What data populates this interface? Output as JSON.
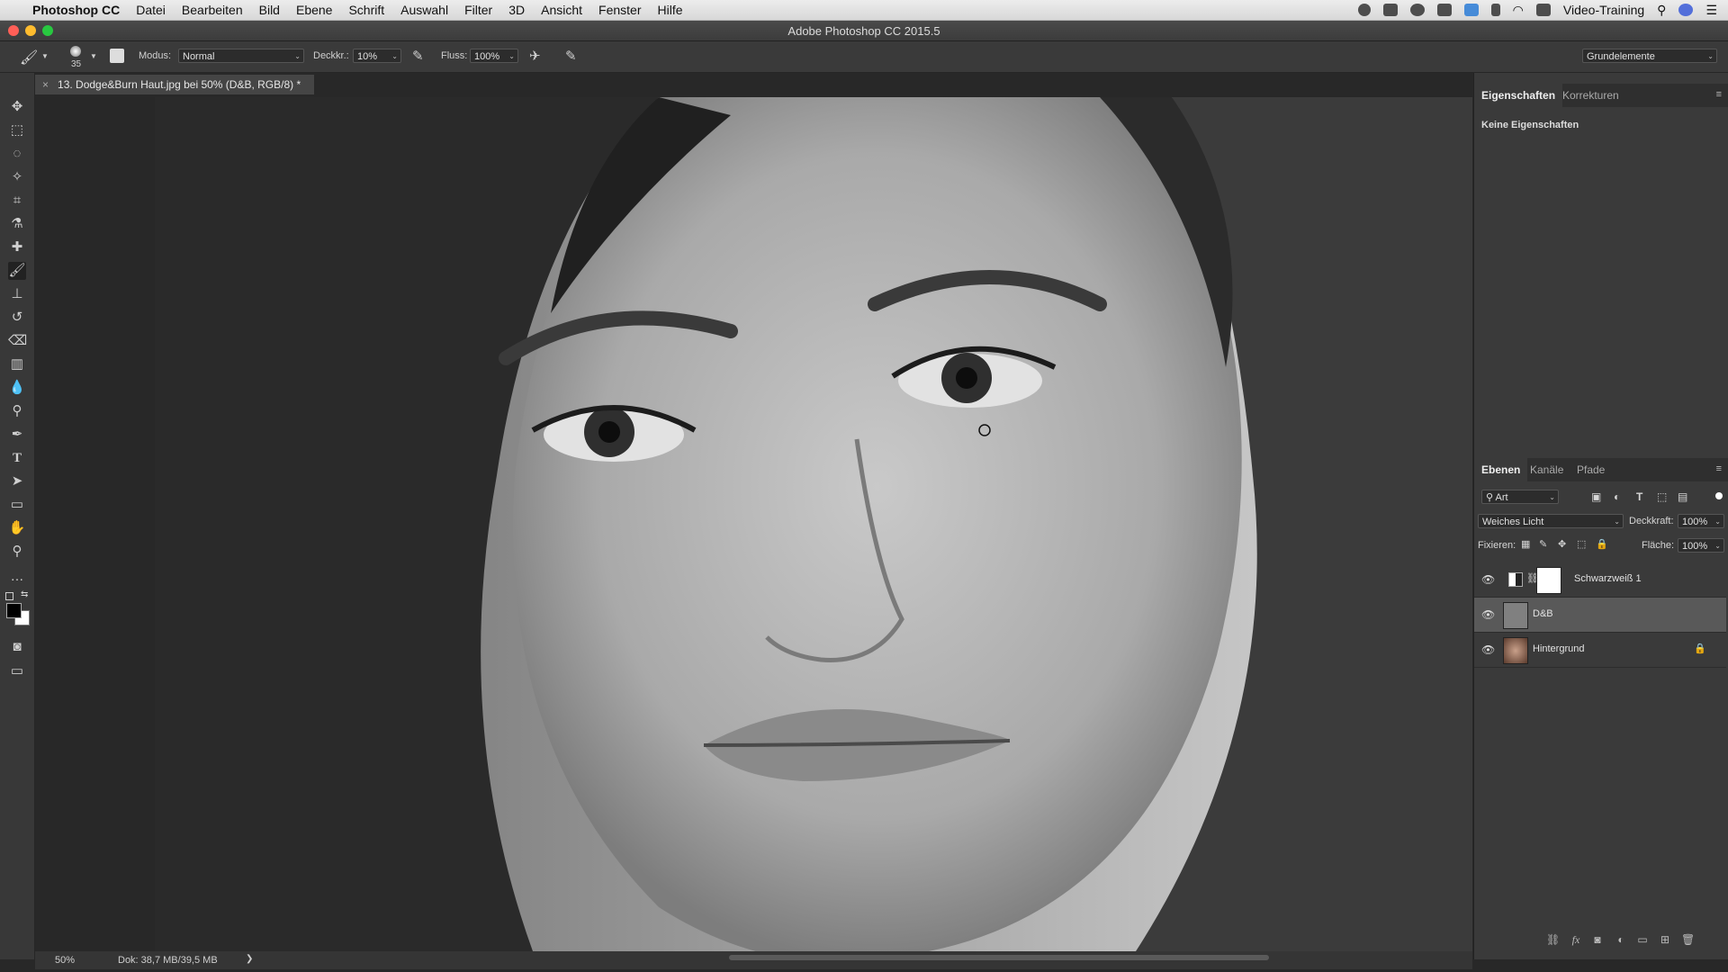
{
  "menubar": {
    "app": "Photoshop CC",
    "items": [
      "Datei",
      "Bearbeiten",
      "Bild",
      "Ebene",
      "Schrift",
      "Auswahl",
      "Filter",
      "3D",
      "Ansicht",
      "Fenster",
      "Hilfe"
    ],
    "user": "Video-Training"
  },
  "window": {
    "title": "Adobe Photoshop CC 2015.5"
  },
  "options": {
    "brush_size": "35",
    "mode_label": "Modus:",
    "mode_value": "Normal",
    "opacity_label": "Deckkr.:",
    "opacity_value": "10%",
    "flow_label": "Fluss:",
    "flow_value": "100%",
    "workspace": "Grundelemente"
  },
  "document": {
    "tab_title": "13. Dodge&Burn Haut.jpg bei 50% (D&B, RGB/8) *",
    "zoom": "50%",
    "doc_info": "Dok: 38,7 MB/39,5 MB"
  },
  "properties": {
    "tabs": [
      "Eigenschaften",
      "Korrekturen"
    ],
    "empty_text": "Keine Eigenschaften"
  },
  "layers_panel": {
    "tabs": [
      "Ebenen",
      "Kanäle",
      "Pfade"
    ],
    "filter_value": "Art",
    "blend_mode": "Weiches Licht",
    "opacity_label": "Deckkraft:",
    "opacity_value": "100%",
    "lock_label": "Fixieren:",
    "fill_label": "Fläche:",
    "fill_value": "100%",
    "layers": [
      {
        "name": "Schwarzweiß 1",
        "selected": false
      },
      {
        "name": "D&B",
        "selected": true
      },
      {
        "name": "Hintergrund",
        "selected": false
      }
    ]
  },
  "colors": {
    "close": "#ff5f57",
    "minimize": "#febc2e",
    "maximize": "#28c840",
    "panel_bg": "#3a3a3a",
    "selected_layer": "#595959"
  }
}
